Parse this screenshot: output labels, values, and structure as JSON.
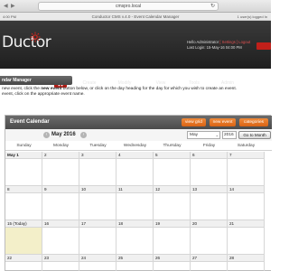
{
  "browser": {
    "url": "cmspro.local",
    "reload": "↻",
    "back": "◀",
    "forward": "▶"
  },
  "titlebar": {
    "time": "4:00 PM",
    "title": "Conductor CMS v.4.0 - Event Calendar Manager",
    "users": "1 user(s) logged In"
  },
  "header": {
    "logo": "Ductor",
    "hello": "Hello Administrator",
    "settings": "[ Settings ]",
    "logout": "Logout",
    "last_login": "Last Login: 15-May-16 04:00 PM"
  },
  "menu": [
    "Create",
    "Modify",
    "View",
    "Tools",
    "Admin"
  ],
  "section": {
    "title": "ndar Manager"
  },
  "intro": {
    "line1a": "new event, click the ",
    "line1b": "new event",
    "line1c": " button below, or click on the day heading for the day for which you wish to create an event.",
    "line2": "event, click on the appropriate event name."
  },
  "calendar": {
    "title": "Event Calendar",
    "buttons": [
      "view grid",
      "new event",
      "categories"
    ],
    "month": "May 2016",
    "select_month": "May",
    "year": "2016",
    "goto": "Go to Month",
    "days": [
      "Sunday",
      "Monday",
      "Tuesday",
      "Wednesday",
      "Thursday",
      "Friday",
      "Saturday"
    ],
    "week1": [
      "May 1",
      "2",
      "3",
      "4",
      "5",
      "6",
      "7"
    ],
    "week2": [
      "8",
      "9",
      "10",
      "11",
      "12",
      "13",
      "14"
    ],
    "week3": [
      "15 (Today)",
      "16",
      "17",
      "18",
      "19",
      "20",
      "21"
    ],
    "week4": [
      "22",
      "23",
      "24",
      "25",
      "26",
      "27",
      "28"
    ]
  },
  "colors": {
    "accent": "#d96415",
    "brand_red": "#c0201a",
    "header": "#2a2a2a",
    "today": "#f3efc9"
  }
}
